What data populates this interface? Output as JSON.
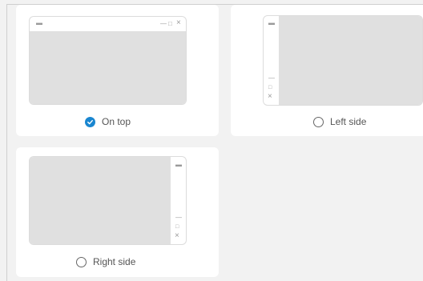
{
  "options": {
    "top": {
      "label": "On top",
      "selected": true
    },
    "left": {
      "label": "Left side",
      "selected": false
    },
    "right": {
      "label": "Right side",
      "selected": false
    }
  },
  "window_controls": {
    "icon": "dash-icon",
    "minimize": "—",
    "maximize": "□",
    "close": "×"
  },
  "colors": {
    "accent": "#1a86d0",
    "preview_fill": "#e0e0e0",
    "card": "#ffffff",
    "background": "#f2f2f2"
  }
}
